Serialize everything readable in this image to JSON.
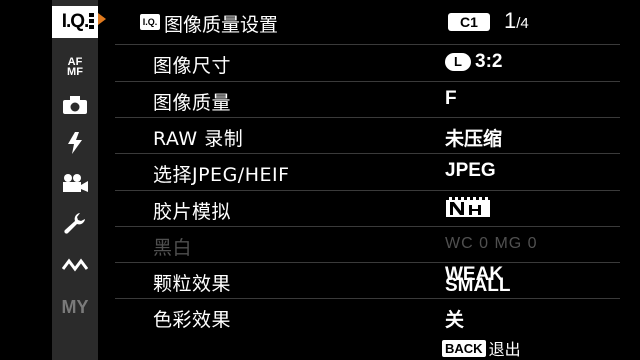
{
  "sidebar": {
    "tabs": [
      {
        "label": "I.Q."
      },
      {
        "label": "AF MF"
      },
      {
        "icon": "camera-icon"
      },
      {
        "icon": "flash-icon"
      },
      {
        "icon": "movie-icon"
      },
      {
        "icon": "wrench-icon"
      },
      {
        "icon": "connection-icon"
      },
      {
        "label": "MY"
      }
    ],
    "active_tab_color": "#ffffff",
    "pointer_color": "#e07a1e"
  },
  "header": {
    "badge": "I.Q.",
    "title": "图像质量设置",
    "custom_slot": "C1",
    "page": "1",
    "page_total": "/4"
  },
  "menu": {
    "items": [
      {
        "label": "图像尺寸",
        "value": "3:2",
        "value_badge": "L"
      },
      {
        "label": "图像质量",
        "value": "F"
      },
      {
        "label": "RAW 录制",
        "value": "未压缩"
      },
      {
        "label": "选择JPEG/HEIF",
        "value": "JPEG"
      },
      {
        "label": "胶片模拟",
        "value_icon": "film-simulation-nh-icon"
      },
      {
        "label": "黑白",
        "value": "WC  0  MG  0",
        "disabled": true
      },
      {
        "label": "颗粒效果",
        "value_line1": "WEAK",
        "value_line2": "SMALL"
      },
      {
        "label": "色彩效果",
        "value": "关"
      }
    ]
  },
  "footer": {
    "key": "BACK",
    "action": "退出"
  }
}
